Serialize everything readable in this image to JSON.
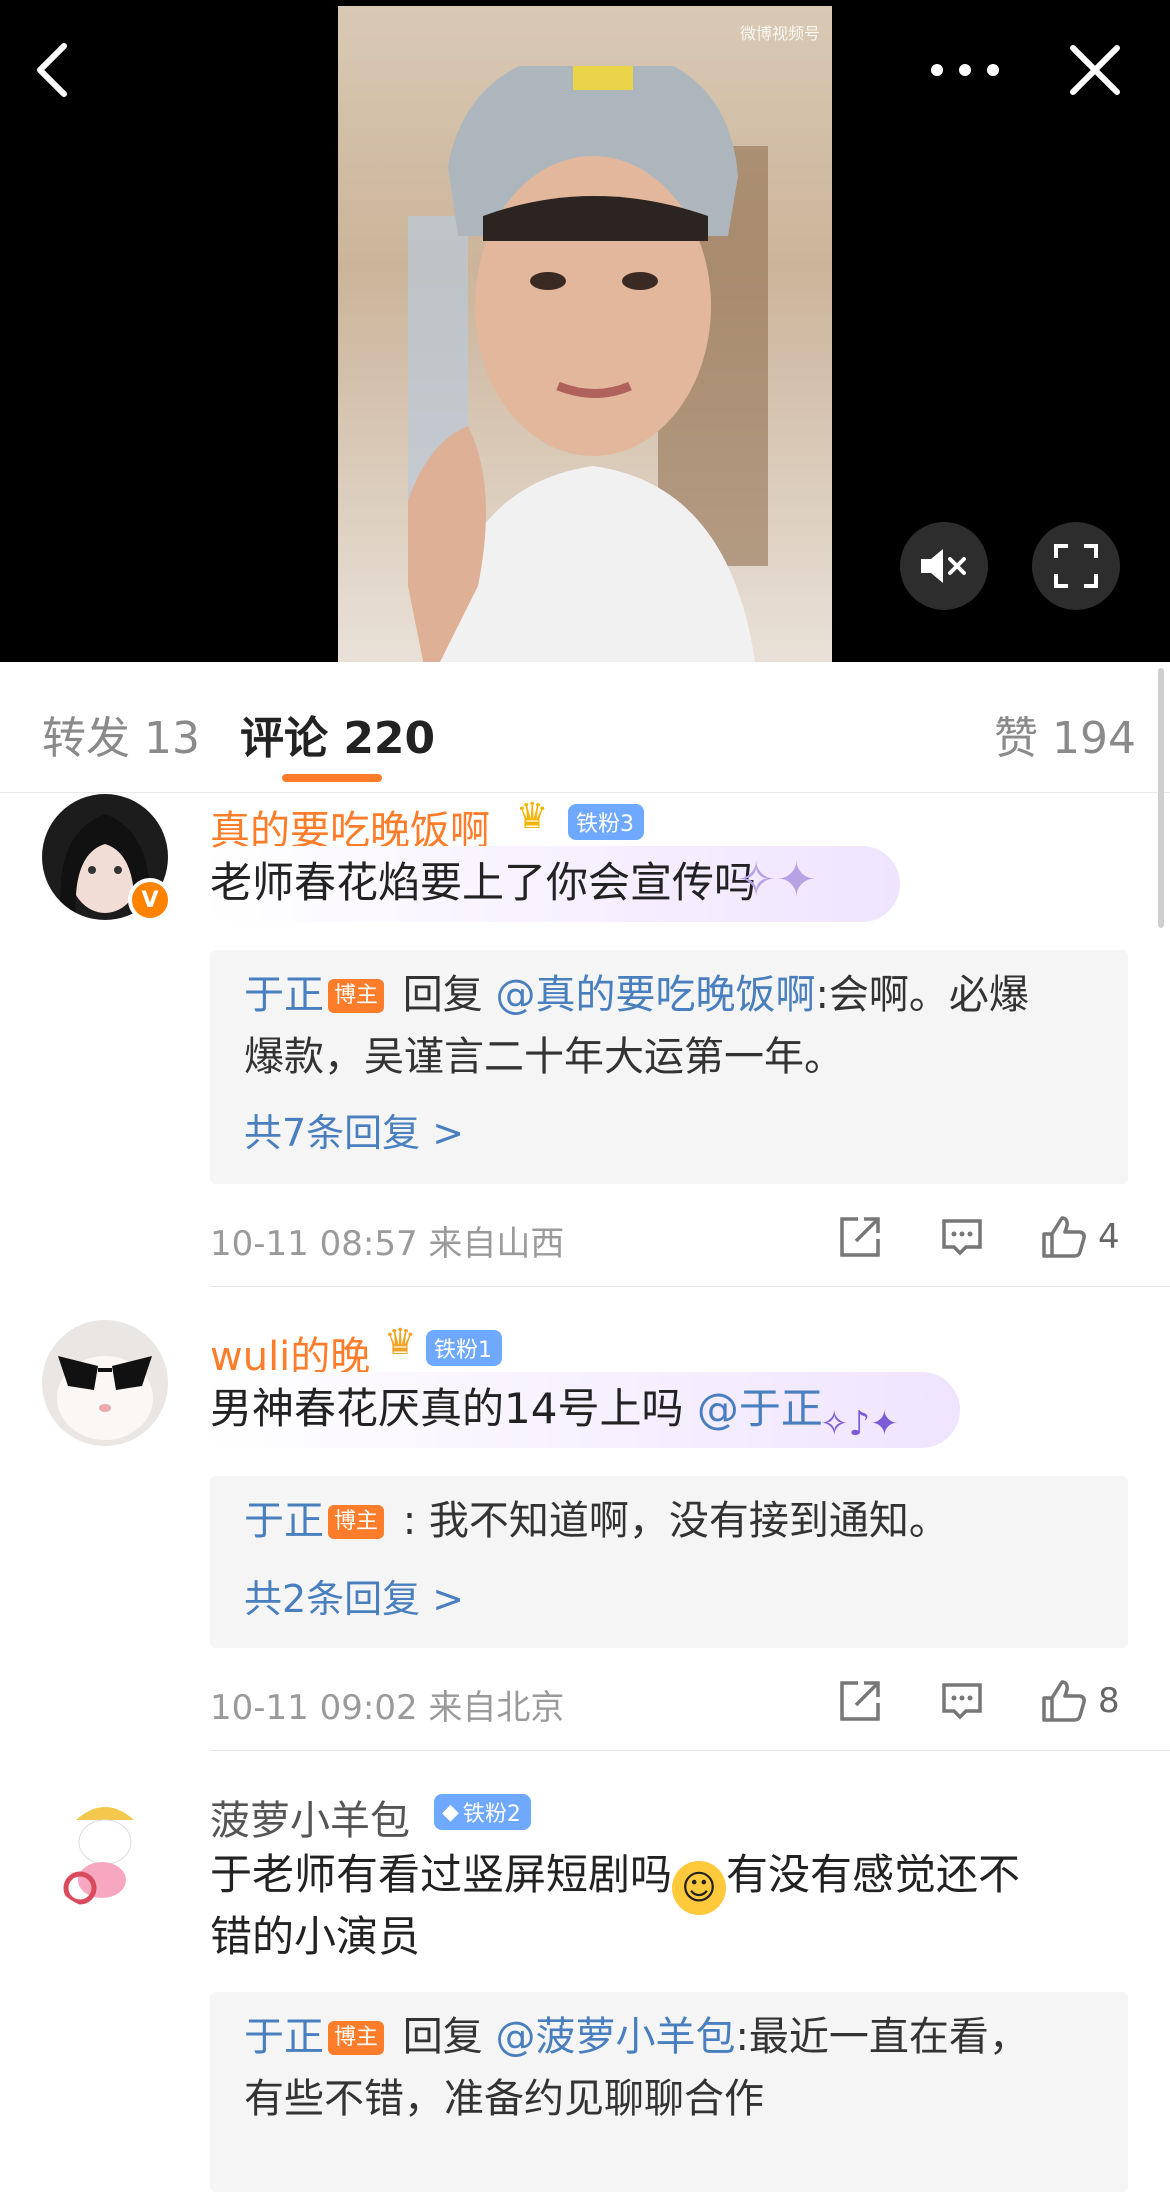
{
  "video": {
    "watermark": "微博视频号",
    "icons": [
      "back-icon",
      "more-icon",
      "close-icon",
      "mute-icon",
      "fullscreen-icon"
    ]
  },
  "tabs": {
    "repost": "转发 13",
    "comments": "评论 220",
    "likes": "赞 194",
    "accent": "#ff7d2a"
  },
  "comments": [
    {
      "username": "真的要吃晚饭啊",
      "fan_badge": "铁粉3",
      "text": "老师春花焰要上了你会宣传吗",
      "reply": {
        "author": "于正",
        "host_label": "博主",
        "reply_prefix": "回复",
        "mention": "@真的要吃晚饭啊",
        "line1": ":会啊。必爆",
        "line2": "爆款，吴谨言二十年大运第一年。"
      },
      "more_replies": "共7条回复 >",
      "time": "10-11 08:57",
      "location": "来自山西",
      "likes": "4"
    },
    {
      "username": "wuli的晚",
      "fan_badge": "铁粉1",
      "text": "男神春花厌真的14号上吗",
      "mention": "@于正",
      "reply": {
        "author": "于正",
        "host_label": "博主",
        "line1": " : 我不知道啊，没有接到通知。"
      },
      "more_replies": "共2条回复 >",
      "time": "10-11 09:02",
      "location": "来自北京",
      "likes": "8"
    },
    {
      "username": "菠萝小羊包",
      "fan_badge": "铁粉2",
      "text_line1a": "于老师有看过竖屏短剧吗",
      "text_line1b": "有没有感觉还不",
      "text_line2": "错的小演员",
      "reply": {
        "author": "于正",
        "host_label": "博主",
        "reply_prefix": "回复",
        "mention": "@菠萝小羊包",
        "line1": ":最近一直在看，",
        "line2": "有些不错，准备约见聊聊合作"
      }
    }
  ]
}
